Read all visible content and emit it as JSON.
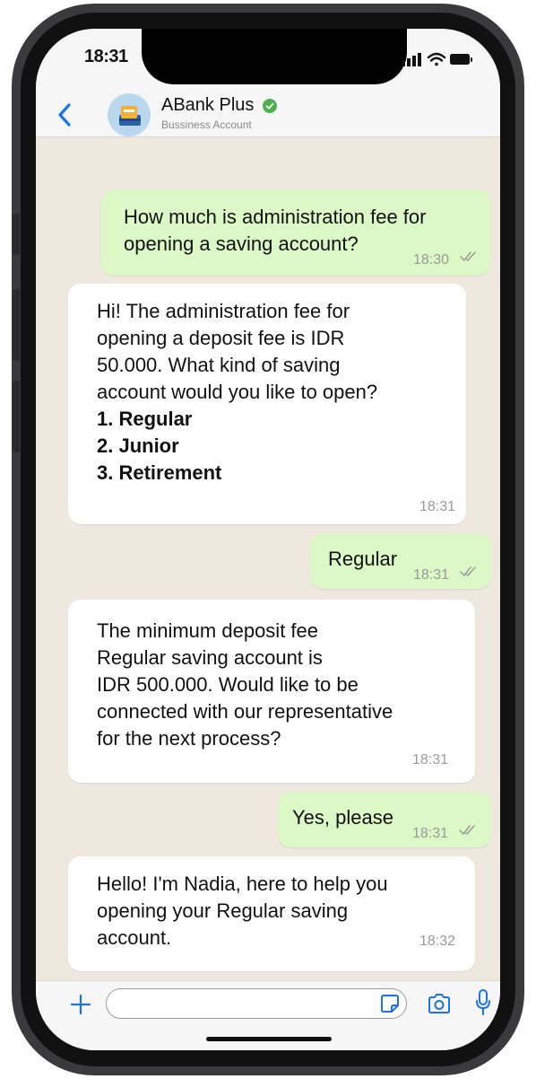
{
  "status_bar": {
    "time": "18:31"
  },
  "header": {
    "contact_name": "ABank Plus",
    "contact_subtitle": "Bussiness Account",
    "accent_color": "#1a73e8",
    "verified_color": "#4caf50"
  },
  "messages": [
    {
      "direction": "outgoing",
      "lines": [
        "How much is administration fee for",
        "opening a saving account?"
      ],
      "time": "18:30",
      "read": true
    },
    {
      "direction": "incoming",
      "lines": [
        "Hi! The administration fee for",
        "opening a deposit fee is IDR",
        "50.000. What kind of saving",
        "account would you like to open?"
      ],
      "bold_lines": [
        "1. Regular",
        "2. Junior",
        "3. Retirement"
      ],
      "time": "18:31"
    },
    {
      "direction": "outgoing",
      "lines": [
        "Regular"
      ],
      "time": "18:31",
      "read": true
    },
    {
      "direction": "incoming",
      "lines": [
        "The minimum deposit fee",
        "Regular saving account is",
        "IDR 500.000. Would like to be",
        "connected with our representative",
        "for the next process?"
      ],
      "time": "18:31"
    },
    {
      "direction": "outgoing",
      "lines": [
        "Yes, please"
      ],
      "time": "18:31",
      "read": true
    },
    {
      "direction": "incoming",
      "lines": [
        "Hello! I'm Nadia, here to help you",
        "opening your Regular saving",
        "account."
      ],
      "time": "18:32"
    }
  ],
  "composer": {
    "value": "",
    "icons": [
      "plus-icon",
      "sticker-icon",
      "camera-icon",
      "microphone-icon"
    ]
  },
  "colors": {
    "outgoing_bubble": "#dcf8c6",
    "incoming_bubble": "#ffffff",
    "chat_background": "#efe8de"
  }
}
